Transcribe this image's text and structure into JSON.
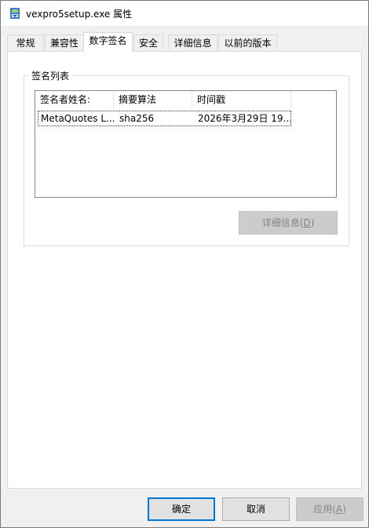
{
  "window": {
    "title": "vexpro5setup.exe 属性",
    "icon": "installer-app-icon"
  },
  "tabs": [
    {
      "label": "常规",
      "active": false
    },
    {
      "label": "兼容性",
      "active": false
    },
    {
      "label": "数字签名",
      "active": true
    },
    {
      "label": "安全",
      "active": false
    },
    {
      "label": "详细信息",
      "active": false
    },
    {
      "label": "以前的版本",
      "active": false
    }
  ],
  "signature_group": {
    "title": "签名列表",
    "columns": [
      "签名者姓名:",
      "摘要算法",
      "时间戳"
    ],
    "rows": [
      {
        "signer": "MetaQuotes L...",
        "digest": "sha256",
        "timestamp": "2026年3月29日 19..."
      }
    ],
    "details_button": {
      "label": "详细信息(",
      "mnemonic": "D",
      "suffix": ")",
      "enabled": false
    }
  },
  "footer": {
    "ok_label": "确定",
    "cancel_label": "取消",
    "apply_label": "应用(",
    "apply_mnemonic": "A",
    "apply_suffix": ")",
    "apply_enabled": false
  },
  "colors": {
    "accent": "#0078d7",
    "panel_bg": "#ffffff",
    "dialog_bg": "#f0f0f0"
  }
}
